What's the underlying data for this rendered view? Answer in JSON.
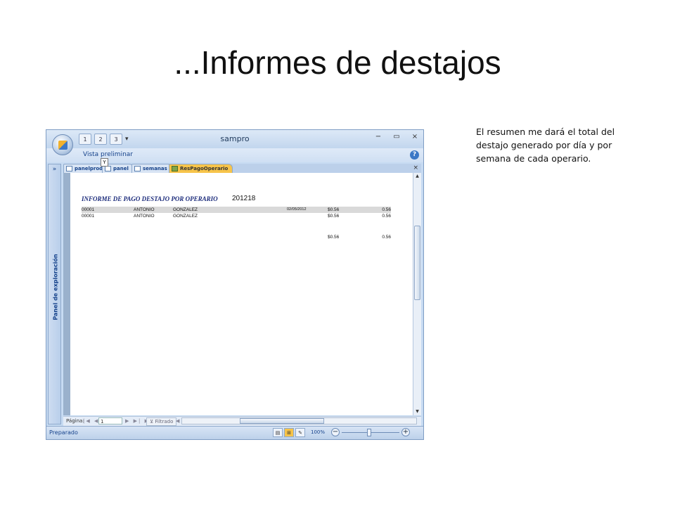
{
  "slide": {
    "title": "...Informes de destajos",
    "note": "El resumen me dará el total del destajo generado por día y por semana de cada operario."
  },
  "app": {
    "title": "sampro",
    "qat_keytips": [
      "1",
      "2",
      "3"
    ],
    "keytip": "Y",
    "ribbon_tab": "Vista preliminar",
    "help": "?",
    "controls": {
      "minimize": "−",
      "restore": "▭",
      "close": "×"
    }
  },
  "nav_pane": {
    "toggle": "»",
    "label": "Panel de exploración"
  },
  "doc_tabs": {
    "items": [
      {
        "label": "panelprod"
      },
      {
        "label": "panel"
      },
      {
        "label": "semanas"
      },
      {
        "label": "ResPagoOperario"
      }
    ],
    "close": "×"
  },
  "report": {
    "title": "INFORME DE PAGO DESTAJO POR OPERARIO",
    "number": "201218",
    "rows": [
      {
        "id": "00001",
        "name": "ANTONIO",
        "last": "GONZALEZ",
        "date": "02/05/2012",
        "amount": "$0.56",
        "total": "0.56"
      },
      {
        "id": "00001",
        "name": "ANTONIO",
        "last": "GONZALEZ",
        "date": "",
        "amount": "$0.56",
        "total": "0.56"
      }
    ],
    "summary": {
      "amount": "$0.56",
      "total": "0.56"
    }
  },
  "record_nav": {
    "label": "Página:",
    "first_prev": "|◀ ◀",
    "next_last": "▶ ▶| ▶*",
    "current": "1",
    "filter": "Filtrado",
    "scroll_left": "◀"
  },
  "status": {
    "text": "Preparado",
    "zoom": "100%",
    "zoom_minus": "−",
    "zoom_plus": "+"
  },
  "colors": {
    "active_tab": "#f7c44a",
    "ribbon": "#c7dbf2",
    "report_title": "#1a2a7a"
  }
}
